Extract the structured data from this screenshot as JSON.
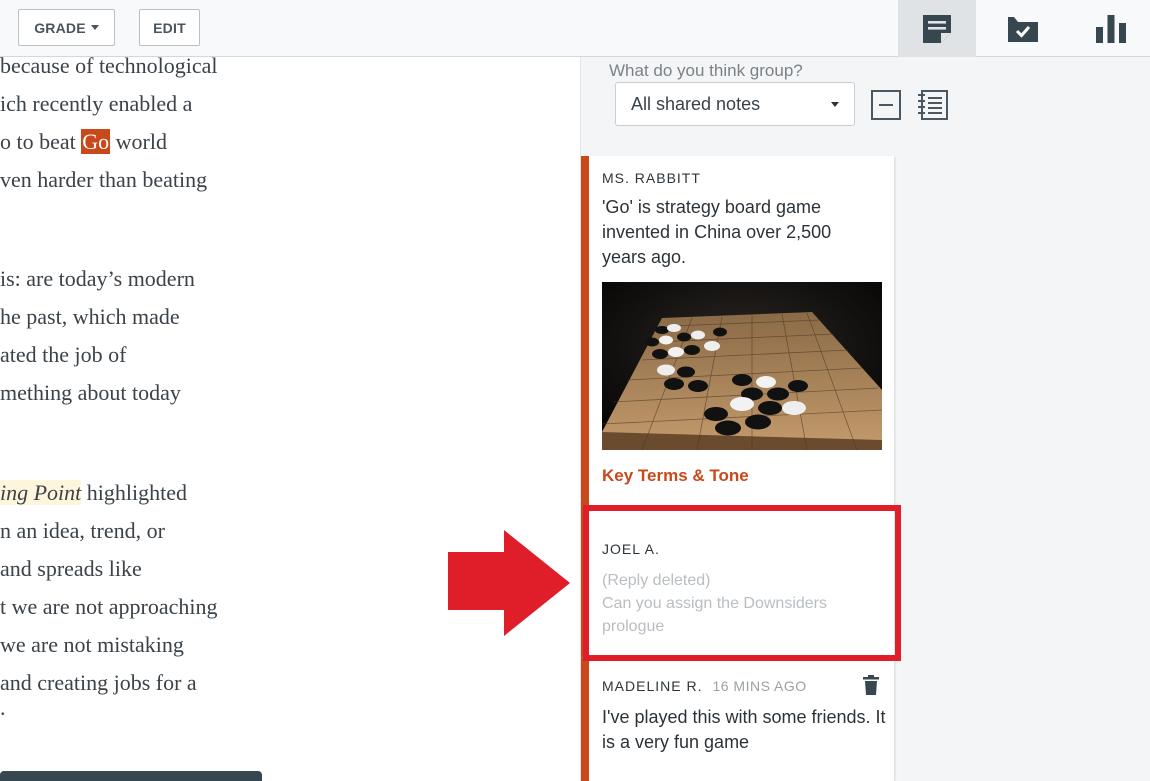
{
  "toolbar": {
    "grade_label": "GRADE",
    "edit_label": "EDIT"
  },
  "view_tabs": [
    {
      "icon": "notes-icon",
      "active": true
    },
    {
      "icon": "tasks-icon",
      "active": false
    },
    {
      "icon": "bar-chart-icon",
      "active": false
    }
  ],
  "reader": {
    "lines": [
      "because of technological",
      "ich recently enabled a",
      "",
      "ven harder than beating",
      "is: are today’s modern",
      "he past, which made",
      "ated the job of",
      "mething about today",
      "",
      "n an idea, trend, or",
      "and spreads like",
      "t we are not approaching",
      "we are not mistaking",
      "and creating jobs for a",
      "."
    ],
    "line3_before": "o to beat ",
    "line3_highlight": "Go",
    "line3_after": " world",
    "line9_highlight": "ing Point",
    "line9_after": " highlighted"
  },
  "sidebar": {
    "prompt": "What do you think group?",
    "filter_value": "All shared notes",
    "notes": [
      {
        "author": "MS. RABBITT",
        "text": "'Go' is strategy board game invented in China over 2,500 years ago.",
        "link": "Key Terms & Tone"
      },
      {
        "author": "JOEL A.",
        "deleted_line1": "(Reply deleted)",
        "deleted_line2": "Can you assign  the Downsiders prologue"
      },
      {
        "author": "MADELINE R.",
        "time": "16 MINS AGO",
        "text": "I've played this with some friends. It is a very fun game"
      }
    ]
  },
  "colors": {
    "accent": "#c9491b",
    "annotation_red": "#e01e2a",
    "icon": "#37474f"
  }
}
